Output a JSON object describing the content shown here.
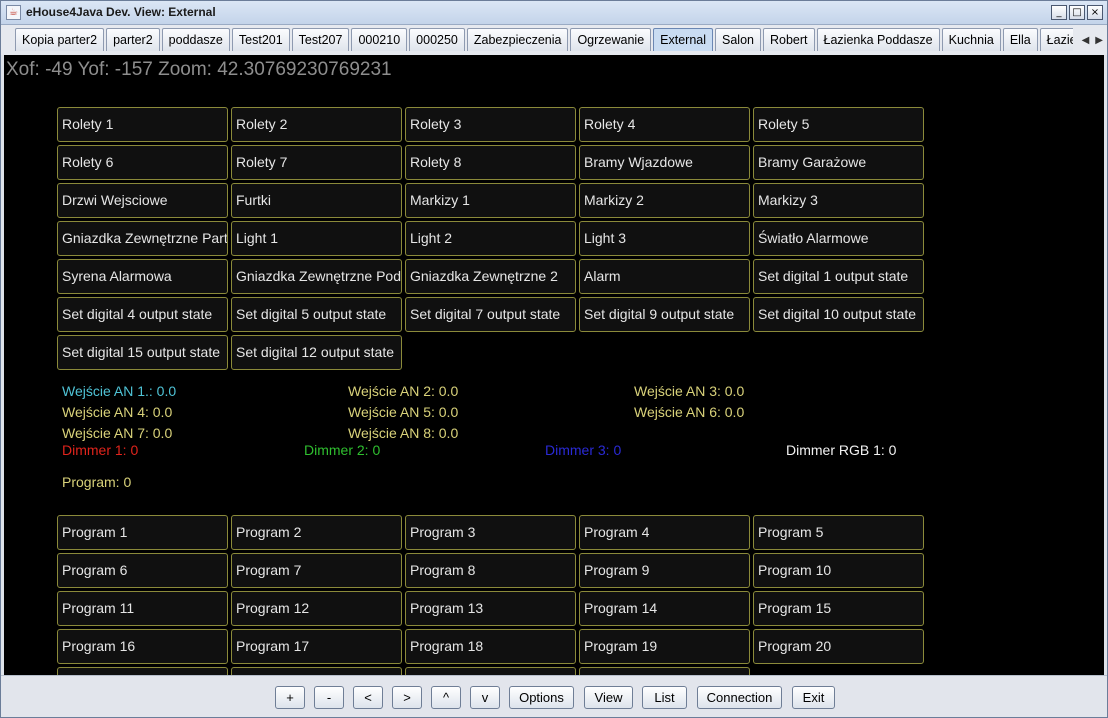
{
  "window": {
    "title": "eHouse4Java Dev. View:   External",
    "min": "_",
    "max": "□",
    "close": "×"
  },
  "tabs": [
    {
      "label": "Kopia parter2"
    },
    {
      "label": "parter2"
    },
    {
      "label": "poddasze"
    },
    {
      "label": "Test201"
    },
    {
      "label": "Test207"
    },
    {
      "label": "000210"
    },
    {
      "label": "000250"
    },
    {
      "label": "Zabezpieczenia"
    },
    {
      "label": "Ogrzewanie"
    },
    {
      "label": "External",
      "active": true
    },
    {
      "label": "Salon"
    },
    {
      "label": "Robert"
    },
    {
      "label": "Łazienka Poddasze"
    },
    {
      "label": "Kuchnia"
    },
    {
      "label": "Ella"
    },
    {
      "label": "Łazie"
    }
  ],
  "tab_arrows": {
    "left": "◀",
    "right": "▶"
  },
  "view_info": "Xof: -49 Yof: -157 Zoom: 42.30769230769231",
  "outputs": [
    "Rolety 1",
    "Rolety 2",
    "Rolety 3",
    "Rolety 4",
    "Rolety 5",
    "Rolety 6",
    "Rolety 7",
    "Rolety 8",
    "Bramy Wjazdowe",
    "Bramy Garażowe",
    "Drzwi Wejsciowe",
    "Furtki",
    "Markizy 1",
    "Markizy 2",
    "Markizy 3",
    "Gniazdka Zewnętrzne Parter",
    "Light 1",
    "Light 2",
    "Light 3",
    "Światło Alarmowe",
    "Syrena Alarmowa",
    "Gniazdka Zewnętrzne Poddasze",
    "Gniazdka Zewnętrzne 2",
    "Alarm",
    "Set digital 1 output state",
    "Set digital 4 output state",
    "Set digital 5 output state",
    "Set digital 7 output state",
    "Set digital 9 output state",
    "Set digital 10 output state",
    "Set digital 15 output state",
    "Set digital 12 output state"
  ],
  "analog": [
    {
      "text": "Wejście AN 1.: 0.0",
      "color": "#4fc3d6"
    },
    {
      "text": "Wejście AN 2: 0.0",
      "color": "#d9d27a"
    },
    {
      "text": "Wejście AN 3: 0.0",
      "color": "#d9d27a"
    },
    {
      "text": "Wejście AN 4: 0.0",
      "color": "#d9d27a"
    },
    {
      "text": "Wejście AN 5: 0.0",
      "color": "#d9d27a"
    },
    {
      "text": "Wejście AN 6: 0.0",
      "color": "#d9d27a"
    },
    {
      "text": "Wejście AN 7: 0.0",
      "color": "#d9d27a"
    },
    {
      "text": "Wejście AN 8: 0.0",
      "color": "#d9d27a"
    }
  ],
  "dimmers": [
    {
      "text": "Dimmer 1: 0",
      "color": "#e0241c"
    },
    {
      "text": "Dimmer 2: 0",
      "color": "#2fbf2f"
    },
    {
      "text": "Dimmer 3: 0",
      "color": "#2a2ad6"
    },
    {
      "text": "Dimmer RGB 1: 0",
      "color": "#f2f2f2"
    }
  ],
  "program_status": {
    "text": "Program: 0",
    "color": "#d9d27a"
  },
  "programs": [
    "Program 1",
    "Program 2",
    "Program 3",
    "Program 4",
    "Program 5",
    "Program 6",
    "Program 7",
    "Program 8",
    "Program 9",
    "Program 10",
    "Program 11",
    "Program 12",
    "Program 13",
    "Program 14",
    "Program 15",
    "Program 16",
    "Program 17",
    "Program 18",
    "Program 19",
    "Program 20",
    "",
    "",
    "",
    ""
  ],
  "buttons": {
    "zoom_in": "+",
    "zoom_out": "-",
    "left": "<",
    "right": ">",
    "up": "^",
    "down": "v",
    "options": "Options",
    "view": "View",
    "list": "List",
    "connection": "Connection",
    "exit": "Exit"
  },
  "colors": {
    "cell_border": "#8b8a3a",
    "cell_text": "#e6e6e6",
    "info_text": "#8e8e8e"
  }
}
